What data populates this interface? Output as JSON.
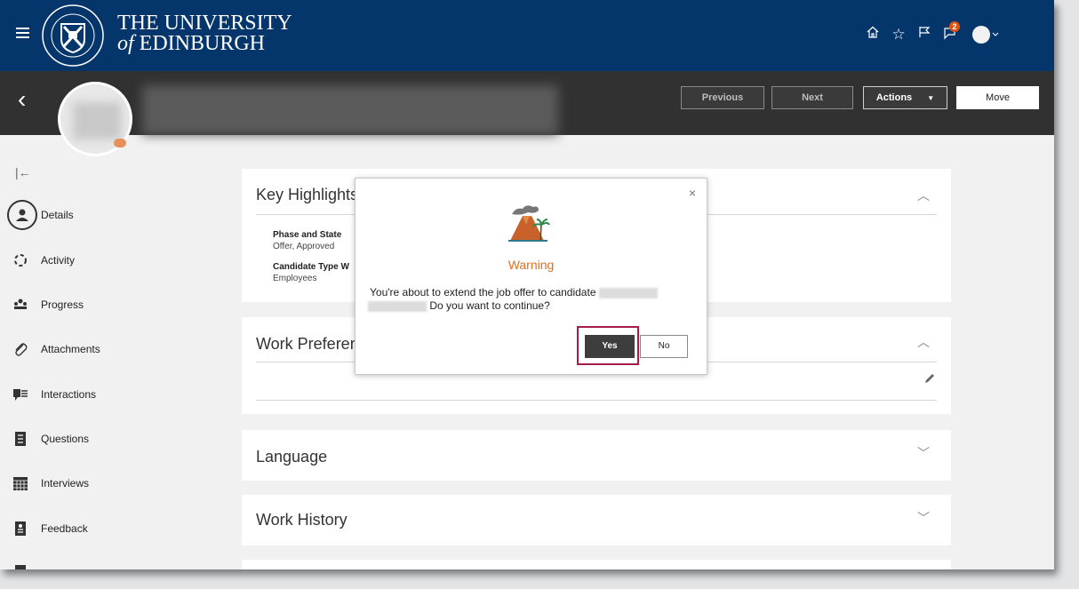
{
  "header": {
    "logo_name": "university-crest",
    "title_line1": "THE UNIVERSITY",
    "title_line2_of": "of",
    "title_line2": " EDINBURGH",
    "notification_count": "2",
    "colors": {
      "brand": "#05366b",
      "subbar": "#313131",
      "accent": "#e07022",
      "highlight": "#a51c4a"
    }
  },
  "toolbar": {
    "previous_label": "Previous",
    "next_label": "Next",
    "actions_label": "Actions",
    "actions_caret": "▼",
    "move_label": "Move"
  },
  "sidebar": {
    "items": [
      {
        "label": "Details",
        "icon": "person-icon"
      },
      {
        "label": "Activity",
        "icon": "activity-icon"
      },
      {
        "label": "Progress",
        "icon": "progress-icon"
      },
      {
        "label": "Attachments",
        "icon": "paperclip-icon"
      },
      {
        "label": "Interactions",
        "icon": "interactions-icon"
      },
      {
        "label": "Questions",
        "icon": "questions-icon"
      },
      {
        "label": "Interviews",
        "icon": "calendar-icon"
      },
      {
        "label": "Feedback",
        "icon": "feedback-icon"
      }
    ]
  },
  "sections": {
    "key_highlights": {
      "title": "Key Highlights",
      "phase_label": "Phase and State",
      "phase_value": "Offer, Approved",
      "type_label": "Candidate Type W",
      "type_value": "Employees"
    },
    "work_preferences": {
      "title": "Work Preferences"
    },
    "language": {
      "title": "Language"
    },
    "work_history": {
      "title": "Work History"
    }
  },
  "dialog": {
    "title": "Warning",
    "message_part1": "You're about to extend the job offer to candidate",
    "message_part2": "Do you want to continue?",
    "yes_label": "Yes",
    "no_label": "No",
    "close_glyph": "×"
  }
}
